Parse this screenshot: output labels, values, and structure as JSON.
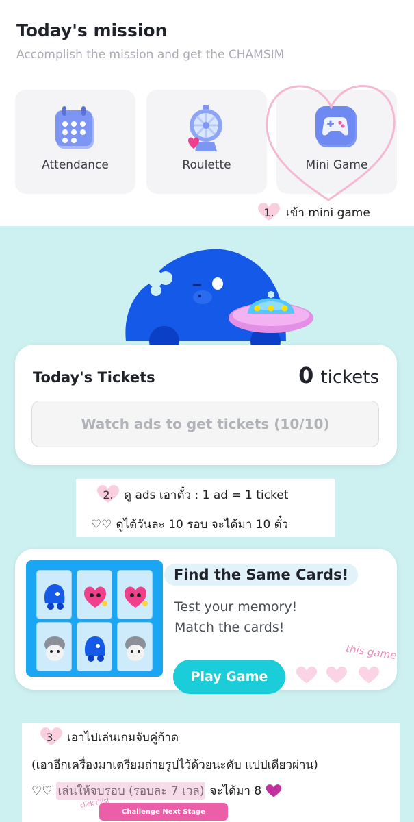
{
  "header": {
    "title": "Today's mission",
    "subtitle": "Accomplish the mission and get the CHAMSIM"
  },
  "missions": [
    {
      "label": "Attendance",
      "icon": "calendar-icon"
    },
    {
      "label": "Roulette",
      "icon": "roulette-icon"
    },
    {
      "label": "Mini Game",
      "icon": "gamepad-icon"
    }
  ],
  "annotations": {
    "step1_num": "1.",
    "step1_text": "เข้า mini game",
    "step2_num": "2.",
    "step2_line1": "ดู ads เอาตั๋ว : 1 ad = 1 ticket",
    "step2_line2_prefix": "♡♡",
    "step2_line2": "ดูได้วันละ 10 รอบ จะได้มา 10 ตั๋ว",
    "step3_num": "3.",
    "step3_line1": "เอาไปเล่นเกมจับคู่ก้าด",
    "step3_line2": "(เอาอีกเครื่องมาเตรียมถ่ายรูปไว้ด้วยนะคับ แปปเดียวผ่าน)",
    "step3_line3_prefix": "♡♡",
    "step3_line3_highlight": "เล่นให้จบรอบ (รอบละ 7 เวล)",
    "step3_line3_suffix": "จะได้มา 8",
    "this_game": "this game",
    "click_this": "click this!"
  },
  "tickets": {
    "title": "Today's Tickets",
    "count": "0",
    "unit": "tickets",
    "watch_button": "Watch ads to get tickets (10/10)"
  },
  "game": {
    "title": "Find the Same Cards!",
    "desc_line1": "Test your memory!",
    "desc_line2": "Match the cards!",
    "play_button": "Play Game",
    "cards": [
      "blue-creature",
      "pink-creature",
      "pink-creature",
      "gray-creature",
      "blue-creature",
      "gray-creature"
    ]
  },
  "challenge_button": "Challenge Next Stage",
  "colors": {
    "cyan_bg": "#cdf0f0",
    "play_button": "#1bcdd8",
    "pink_accent": "#ea5fa7",
    "cards_panel": "#1aa6f2"
  }
}
